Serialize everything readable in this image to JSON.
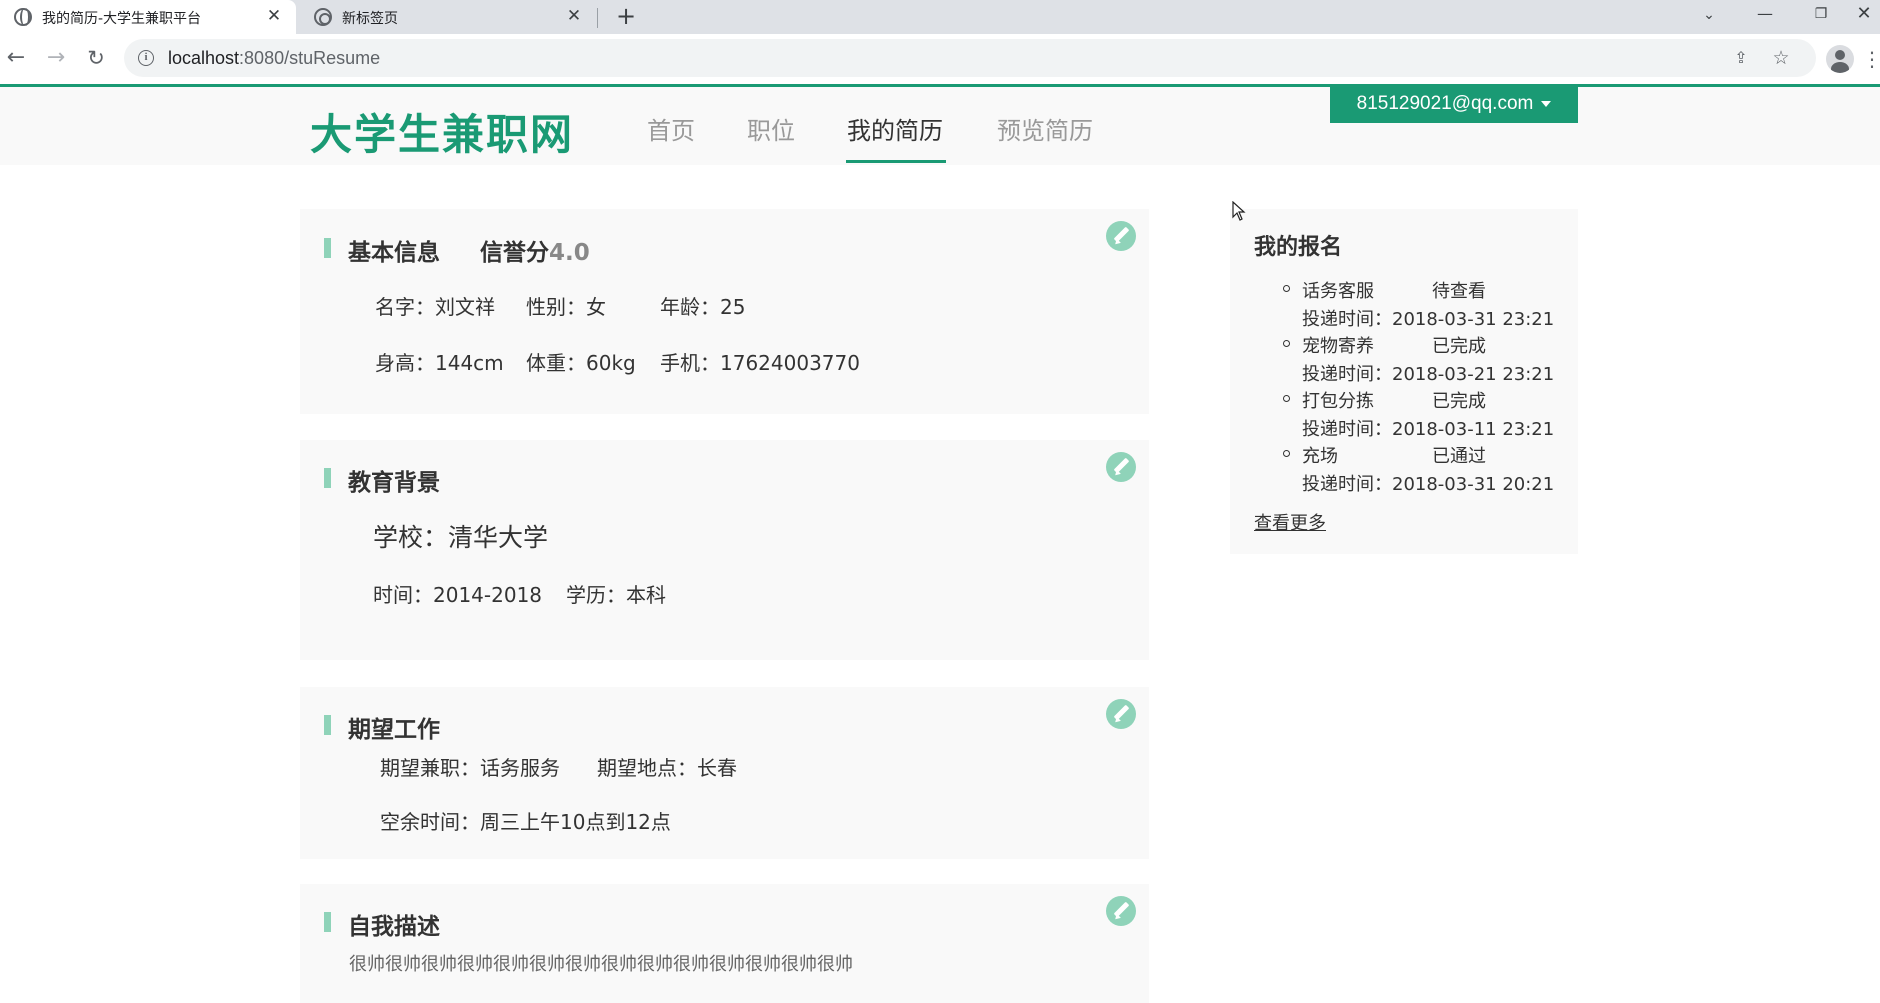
{
  "browser": {
    "tabs": [
      {
        "title": "我的简历-大学生兼职平台",
        "icon": "globe-icon",
        "active": true
      },
      {
        "title": "新标签页",
        "icon": "chrome-icon",
        "active": false
      }
    ],
    "close_glyph": "✕",
    "newtab_glyph": "+",
    "url_host": "localhost",
    "url_path": ":8080/stuResume",
    "win_buttons": {
      "chevron": "⌄",
      "minimize": "—",
      "maximize": "❐",
      "close": "✕"
    }
  },
  "site": {
    "logo": "大学生兼职网",
    "nav": [
      "首页",
      "职位",
      "我的简历",
      "预览简历"
    ],
    "active_nav": "我的简历",
    "user_email": "815129021@qq.com",
    "accent_color": "#1a9a74",
    "accent_light": "#8fd3b9"
  },
  "basic_info": {
    "title": "基本信息",
    "credit_label": "信誉分",
    "credit_value": "4.0",
    "name": "名字：刘文祥",
    "gender": "性别：女",
    "age": "年龄：25",
    "height": "身高：144cm",
    "weight": "体重：60kg",
    "phone": "手机：17624003770"
  },
  "education": {
    "title": "教育背景",
    "school": "学校：清华大学",
    "period": "时间：2014-2018",
    "degree": "学历：本科"
  },
  "expected_job": {
    "title": "期望工作",
    "job": "期望兼职：话务服务",
    "location": "期望地点：长春",
    "free_time": "空余时间：周三上午10点到12点"
  },
  "self_desc": {
    "title": "自我描述",
    "text": "很帅很帅很帅很帅很帅很帅很帅很帅很帅很帅很帅很帅很帅很帅"
  },
  "applications": {
    "title": "我的报名",
    "items": [
      {
        "job": "话务客服",
        "status": "待查看",
        "time": "投递时间：2018-03-31 23:21"
      },
      {
        "job": "宠物寄养",
        "status": "已完成",
        "time": "投递时间：2018-03-21 23:21"
      },
      {
        "job": "打包分拣",
        "status": "已完成",
        "time": "投递时间：2018-03-11 23:21"
      },
      {
        "job": "充场",
        "status": "已通过",
        "time": "投递时间：2018-03-31 20:21"
      }
    ],
    "more": "查看更多"
  }
}
